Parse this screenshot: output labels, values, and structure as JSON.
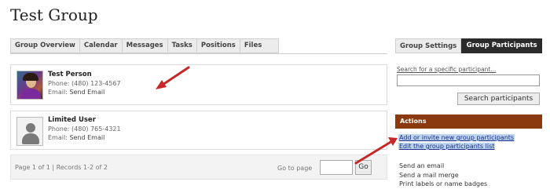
{
  "page": {
    "title": "Test Group"
  },
  "tabs": [
    "Group Overview",
    "Calendar",
    "Messages",
    "Tasks",
    "Positions",
    "Files"
  ],
  "right_tabs": {
    "settings": "Group Settings",
    "participants": "Group Participants"
  },
  "participants": [
    {
      "name": "Test Person",
      "phone": "Phone: (480) 123-4567",
      "email_label": "Email:",
      "email_link": "Send Email"
    },
    {
      "name": "Limited User",
      "phone": "Phone: (480) 765-4321",
      "email_label": "Email:",
      "email_link": "Send Email"
    }
  ],
  "pager": {
    "summary": "Page 1 of 1  |  Records 1-2 of 2",
    "goto_label": "Go to page",
    "go_button": "Go"
  },
  "search": {
    "label": "Search for a specific participant...",
    "button": "Search participants"
  },
  "actions": {
    "header": "Actions",
    "highlighted_links": [
      "Add or invite new group participants",
      "Edit the group participants list"
    ],
    "links": [
      "Send an email",
      "Send a mail merge",
      "Print labels or name badges"
    ]
  },
  "colors": {
    "actions_header": "#8a3a0e",
    "active_tab": "#2b2b2b",
    "annotation_arrow": "#c62828",
    "link_highlight": "#bcd6ef"
  }
}
